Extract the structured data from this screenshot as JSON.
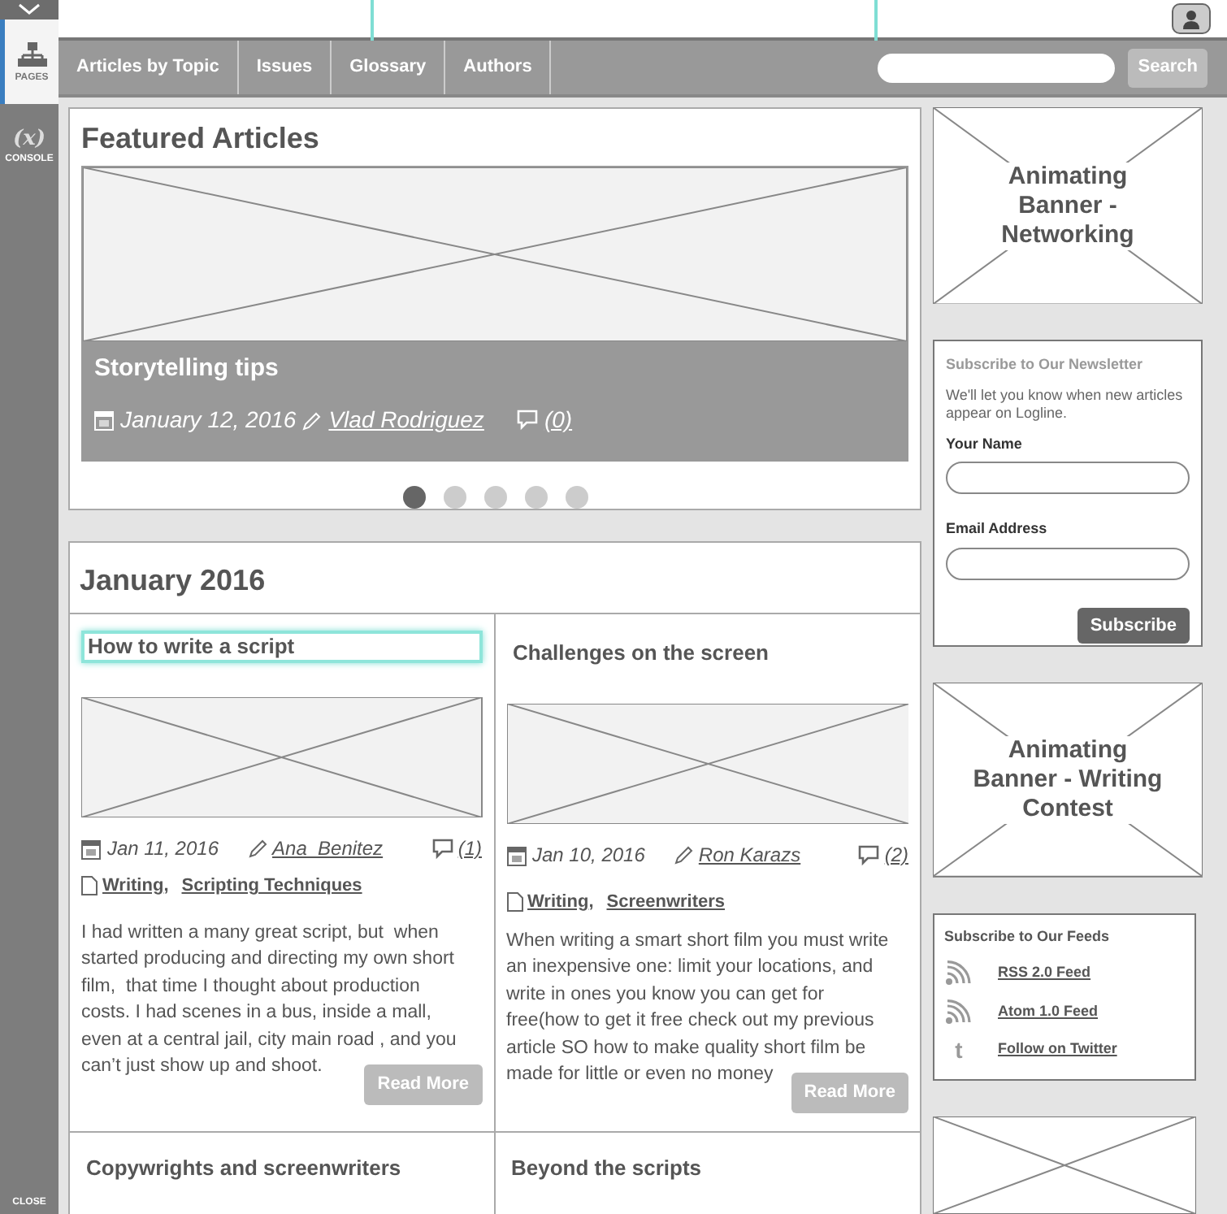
{
  "tool_sidebar": {
    "items": [
      {
        "kind": "pages",
        "label": "PAGES",
        "selected": true
      },
      {
        "kind": "console",
        "glyph": "(x)",
        "label": "CONSOLE",
        "selected": false
      }
    ],
    "close": "CLOSE"
  },
  "nav": {
    "tabs": [
      {
        "label": "Articles by Topic"
      },
      {
        "label": "Issues"
      },
      {
        "label": "Glossary"
      },
      {
        "label": "Authors"
      }
    ],
    "search_button": "Search"
  },
  "featured": {
    "title": "Featured Articles",
    "slide": {
      "title": "Storytelling tips",
      "date": "January 12, 2016",
      "author": "Vlad Rodriguez",
      "comments": "(0)"
    },
    "dots": [
      {
        "selected": true
      },
      {
        "selected": false
      },
      {
        "selected": false
      },
      {
        "selected": false
      },
      {
        "selected": false
      }
    ]
  },
  "month": {
    "title": "January 2016",
    "articles": [
      {
        "title": "How to write a script",
        "selected": true,
        "date": "Jan 11, 2016",
        "author": "Ana  Benitez",
        "comments": "(1)",
        "tags": [
          "Writing",
          "Scripting Techniques"
        ],
        "excerpt": "I had written a many great script, but  when started producing and directing my own short film,  that time I thought about production costs. I had scenes in a bus, inside a mall, even at a central jail, city main road , and you can’t just show up and shoot.",
        "button": "Read More"
      },
      {
        "title": "Challenges on the screen",
        "selected": false,
        "date": "Jan 10, 2016",
        "author": "Ron Karazs",
        "comments": "(2)",
        "tags": [
          "Writing",
          "Screenwriters"
        ],
        "excerpt": "When writing a smart short film you must write an inexpensive one: limit your locations, and write in ones you know you can get for free(how to get it free check out my previous article SO how to make quality short film be made for little or even no money",
        "button": "Read More"
      }
    ],
    "tag_separator": ",",
    "more_titles": [
      "Copywrights and screenwriters",
      "Beyond the scripts"
    ]
  },
  "right": {
    "banner_top": "Animating Banner - Networking",
    "newsletter": {
      "title": "Subscribe to Our Newsletter",
      "text": "We'll let you know when new articles appear on Logline.",
      "fields": [
        {
          "label": "Your Name"
        },
        {
          "label": "Email Address"
        }
      ],
      "button": "Subscribe"
    },
    "banner_mid": "Animating Banner - Writing Contest",
    "feeds": {
      "title": "Subscribe to Our Feeds",
      "links": [
        {
          "kind": "rss",
          "label": "RSS 2.0 Feed"
        },
        {
          "kind": "rss",
          "label": "Atom 1.0 Feed"
        },
        {
          "kind": "tumblr",
          "glyph": "t",
          "label": "Follow on Twitter"
        }
      ]
    }
  }
}
